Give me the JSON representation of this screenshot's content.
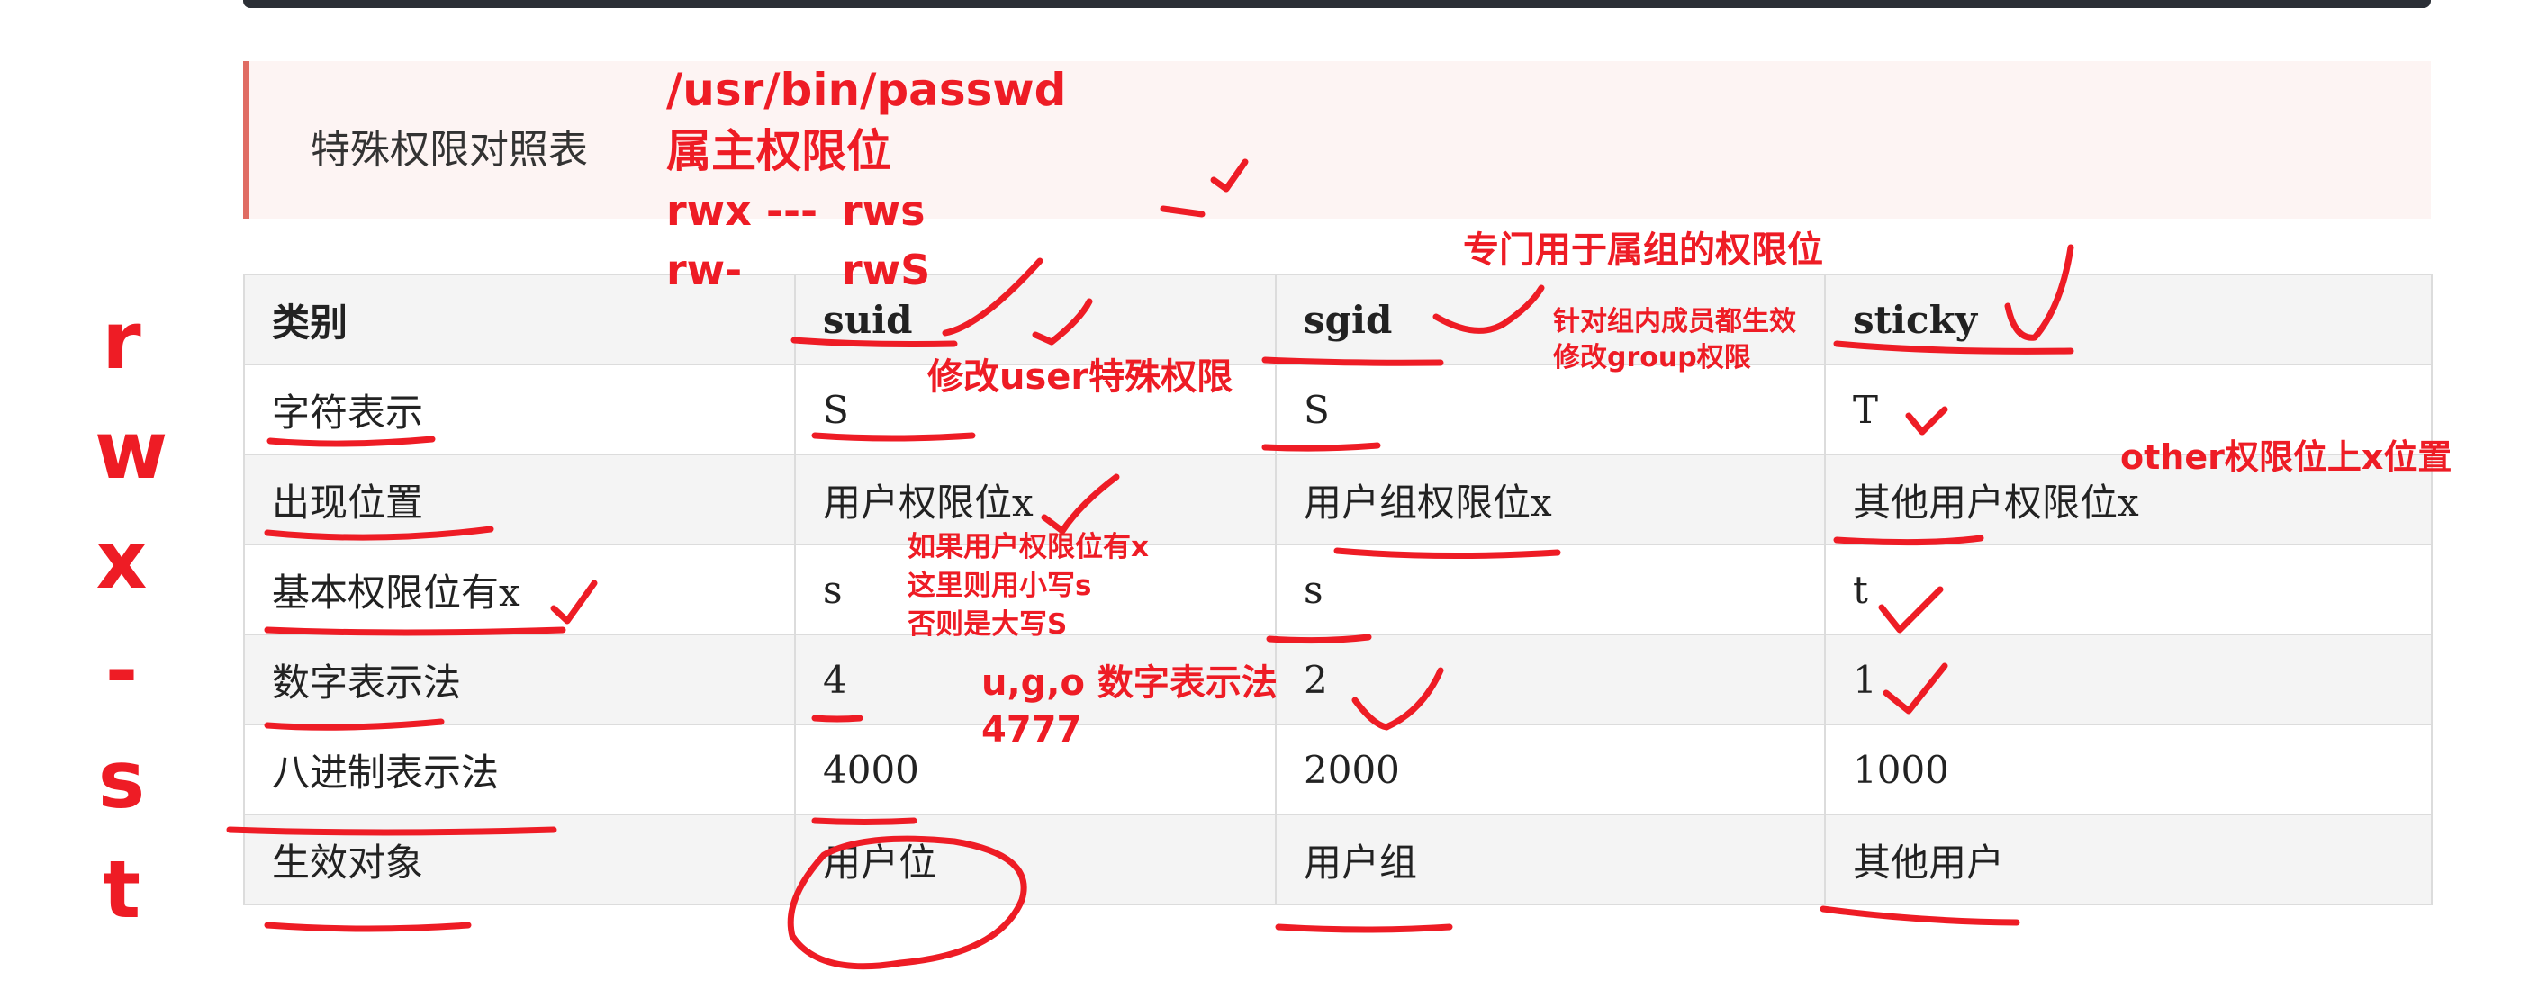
{
  "callout": {
    "title": "特殊权限对照表"
  },
  "table": {
    "header": [
      "类别",
      "suid",
      "sgid",
      "sticky"
    ],
    "rows": [
      [
        "字符表示",
        "S",
        "S",
        "T"
      ],
      [
        "出现位置",
        "用户权限位x",
        "用户组权限位x",
        "其他用户权限位x"
      ],
      [
        "基本权限位有x",
        "s",
        "s",
        "t"
      ],
      [
        "数字表示法",
        "4",
        "2",
        "1"
      ],
      [
        "八进制表示法",
        "4000",
        "2000",
        "1000"
      ],
      [
        "生效对象",
        "用户位",
        "用户组",
        "其他用户"
      ]
    ]
  },
  "annotations": {
    "passwd_path": "/usr/bin/passwd",
    "owner_bit": "属主权限位",
    "rwx_line": "rwx ---",
    "rws": "rws",
    "rw_line": "rw-",
    "rwS": "rwS",
    "group_bit_note": "专门用于属组的权限位",
    "group_effect_1": "针对组内成员都生效",
    "group_effect_2": "修改group权限",
    "suid_note": "修改user特殊权限",
    "other_note": "other权限位上x位置",
    "case_note_1": "如果用户权限位有x",
    "case_note_2": "这里则用小写s",
    "case_note_3": "否则是大写S",
    "ugo_note": "u,g,o 数字表示法",
    "ugo_example": "4777",
    "side_letters": [
      "r",
      "w",
      "x",
      "-",
      "s",
      "t"
    ]
  },
  "colors": {
    "ink": "#ee1c25",
    "callout_bar": "#e06c63",
    "callout_bg": "#fdf4f3",
    "row_alt": "#f4f4f4"
  }
}
